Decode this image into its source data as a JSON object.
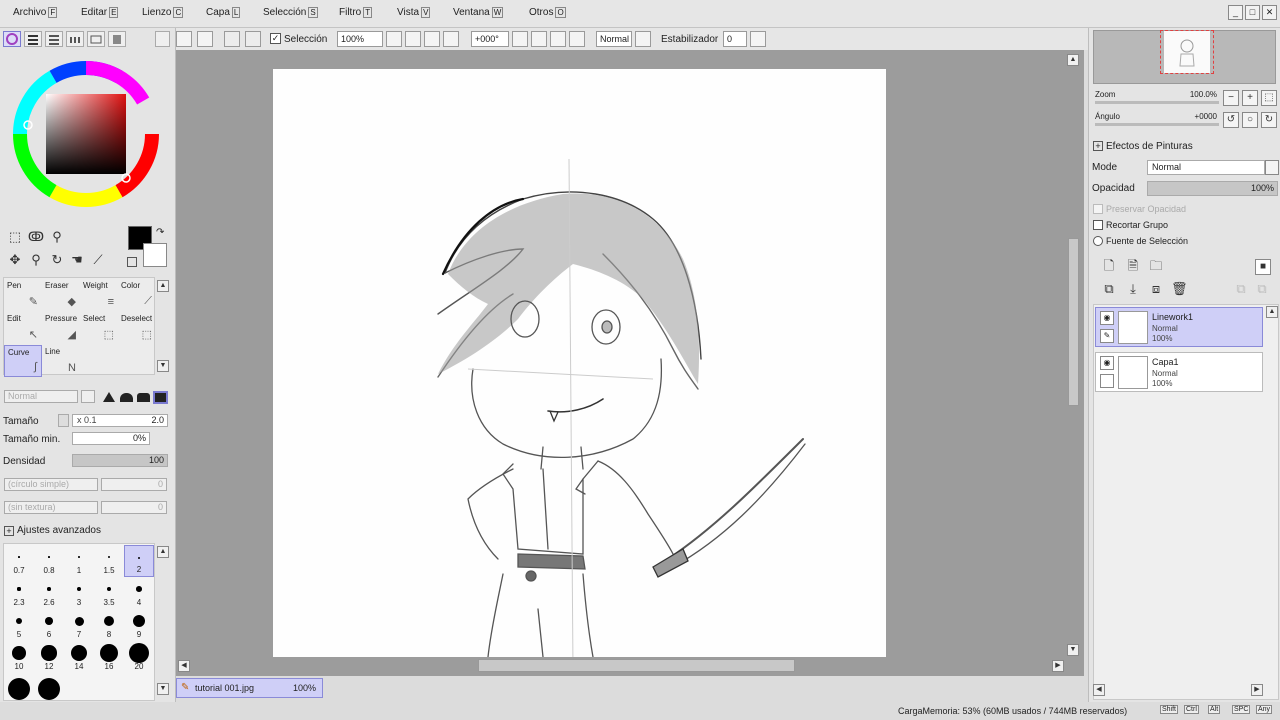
{
  "menu": [
    {
      "label": "Archivo",
      "key": "F"
    },
    {
      "label": "Editar",
      "key": "E"
    },
    {
      "label": "Lienzo",
      "key": "C"
    },
    {
      "label": "Capa",
      "key": "L"
    },
    {
      "label": "Selección",
      "key": "S"
    },
    {
      "label": "Filtro",
      "key": "T"
    },
    {
      "label": "Vista",
      "key": "V"
    },
    {
      "label": "Ventana",
      "key": "W"
    },
    {
      "label": "Otros",
      "key": "O"
    }
  ],
  "toolbar": {
    "selection_label": "Selección",
    "zoom": "100%",
    "rotation": "+000°",
    "blend": "Normal",
    "stabilizer_label": "Estabilizador",
    "stabilizer_value": "0"
  },
  "tools": {
    "cells": [
      {
        "label": "Pen",
        "icon": "✎"
      },
      {
        "label": "Eraser",
        "icon": "◆"
      },
      {
        "label": "Weight",
        "icon": "≡"
      },
      {
        "label": "Color",
        "icon": "⟋"
      },
      {
        "label": "Edit",
        "icon": "↖"
      },
      {
        "label": "Pressure",
        "icon": "◢"
      },
      {
        "label": "Select",
        "icon": "⬚"
      },
      {
        "label": "Deselect",
        "icon": "⬚"
      },
      {
        "label": "Curve",
        "icon": "∫"
      },
      {
        "label": "Line",
        "icon": "N"
      }
    ],
    "blend_mode": "Normal",
    "size_label": "Tamaño",
    "size_mult": "x 0.1",
    "size_value": "2.0",
    "minsize_label": "Tamaño min.",
    "minsize_value": "0%",
    "density_label": "Densidad",
    "density_value": "100",
    "shape": "(círculo simple)",
    "shape_value": "0",
    "texture": "(sin textura)",
    "texture_value": "0",
    "advanced_label": "Ajustes avanzados",
    "brush_sizes": [
      "0.7",
      "0.8",
      "1",
      "1.5",
      "2",
      "2.3",
      "2.6",
      "3",
      "3.5",
      "4",
      "5",
      "6",
      "7",
      "8",
      "9",
      "10",
      "12",
      "14",
      "16",
      "20",
      "",
      ""
    ],
    "brush_size_fill": [
      0.05,
      0.07,
      0.09,
      0.11,
      0.14,
      0.16,
      0.18,
      0.21,
      0.24,
      0.28,
      0.33,
      0.39,
      0.45,
      0.52,
      0.6,
      0.68,
      0.76,
      0.84,
      0.92,
      1.0,
      1.1,
      1.1
    ]
  },
  "document": {
    "name": "tutorial 001.jpg",
    "zoom": "100%"
  },
  "navigator": {
    "zoom_label": "Zoom",
    "zoom_value": "100.0%",
    "angle_label": "Ángulo",
    "angle_value": "+0000"
  },
  "layers_panel": {
    "effects_label": "Efectos de Pinturas",
    "mode_label": "Mode",
    "mode_value": "Normal",
    "opacity_label": "Opacidad",
    "opacity_value": "100%",
    "preserve_opacity": "Preservar Opacidad",
    "clip_group": "Recortar Grupo",
    "selection_source": "Fuente de Selección",
    "layers": [
      {
        "name": "Linework1",
        "mode": "Normal",
        "opacity": "100%"
      },
      {
        "name": "Capa1",
        "mode": "Normal",
        "opacity": "100%"
      }
    ]
  },
  "status": {
    "memory": "CargaMemoria: 53% (60MB usados / 744MB reservados)",
    "keys": [
      "Shift",
      "Ctrl",
      "Alt",
      "SPC",
      "Any"
    ]
  },
  "colors": {
    "primary": "#000000",
    "secondary": "#ffffff",
    "selected_layer": "#cfcff7",
    "accent": "#b8b8f0"
  }
}
